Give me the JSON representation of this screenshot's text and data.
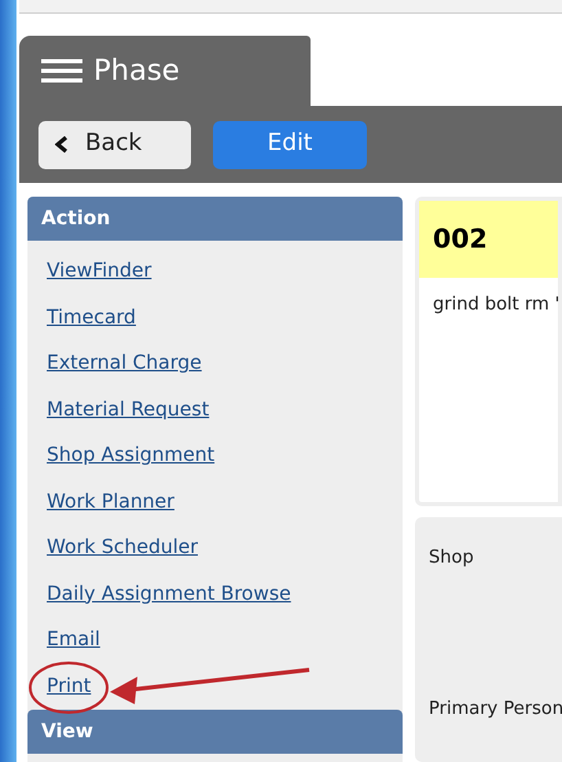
{
  "header": {
    "title": "Phase"
  },
  "toolbar": {
    "back": "Back",
    "edit": "Edit"
  },
  "sidebar": {
    "sections": [
      {
        "title": "Action",
        "items": [
          {
            "label": "ViewFinder",
            "highlighted": false
          },
          {
            "label": "Timecard",
            "highlighted": false
          },
          {
            "label": "External Charge",
            "highlighted": false
          },
          {
            "label": "Material Request",
            "highlighted": false
          },
          {
            "label": "Shop Assignment",
            "highlighted": false
          },
          {
            "label": "Work Planner",
            "highlighted": false
          },
          {
            "label": "Work Scheduler",
            "highlighted": false
          },
          {
            "label": "Daily Assignment Browse",
            "highlighted": false
          },
          {
            "label": "Email",
            "highlighted": false
          },
          {
            "label": "Print",
            "highlighted": true
          }
        ]
      },
      {
        "title": "View"
      }
    ]
  },
  "record": {
    "number": "002",
    "description": "grind bolt rm '"
  },
  "details": [
    {
      "label": "Shop"
    },
    {
      "label": "Primary Person"
    }
  ]
}
